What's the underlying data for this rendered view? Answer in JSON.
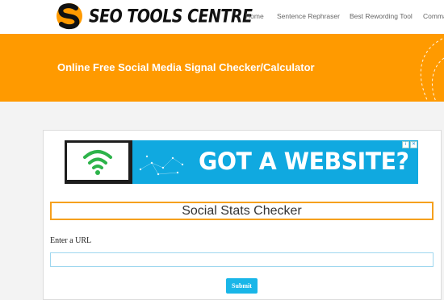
{
  "header": {
    "logo_text": "SEO TOOLS CENTRE",
    "nav": [
      {
        "label": "Home"
      },
      {
        "label": "Sentence Rephraser"
      },
      {
        "label": "Best Rewording Tool"
      },
      {
        "label": "Comma"
      }
    ]
  },
  "hero": {
    "title": "Online Free Social Media Signal Checker/Calculator"
  },
  "ad": {
    "headline": "GOT A WEBSITE?",
    "badges": [
      "i",
      "✕"
    ]
  },
  "tool": {
    "title": "Social Stats Checker",
    "url_label": "Enter a URL",
    "url_value": "",
    "submit_label": "Submit"
  },
  "colors": {
    "brand_orange": "#ff9a00",
    "ad_blue": "#10a9e0",
    "button_blue": "#19b6e8",
    "wifi_green": "#2db34a"
  },
  "icons": [
    "logo-s-icon",
    "wifi-icon"
  ]
}
